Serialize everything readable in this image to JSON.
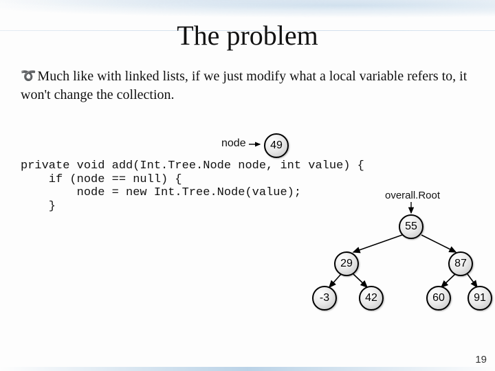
{
  "title": "The problem",
  "bullet_glyph": "➰",
  "body_text": "Much like with linked lists, if we just modify what a local variable refers to, it won't change the collection.",
  "code": "private void add(Int.Tree.Node node, int value) {\n    if (node == null) {\n        node = new Int.Tree.Node(value);\n    }",
  "node_label": "node",
  "overall_root_label": "overall.Root",
  "tree_nodes": {
    "detached": "49",
    "root": "55",
    "l": "29",
    "r": "87",
    "ll": "-3",
    "lr": "42",
    "rl": "60",
    "rr": "91"
  },
  "page_number": "19"
}
